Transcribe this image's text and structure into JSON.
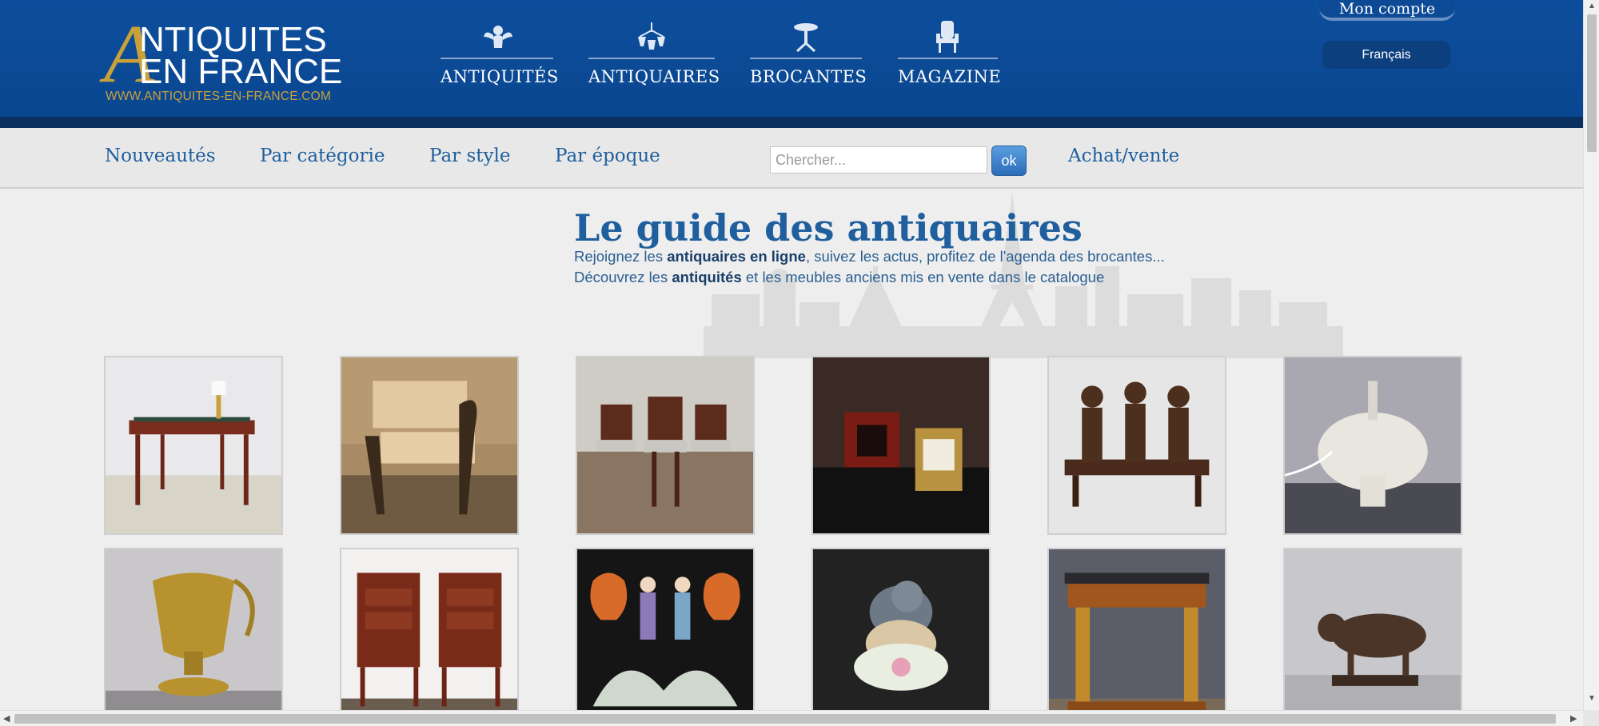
{
  "header": {
    "logo": {
      "big_letter": "A",
      "line1": "NTIQUITES",
      "line2": "EN FRANCE",
      "url": "WWW.ANTIQUITES-EN-FRANCE.COM"
    },
    "nav": [
      {
        "label": "ANTIQUITÉS",
        "icon": "cherub-icon"
      },
      {
        "label": "ANTIQUAIRES",
        "icon": "chandelier-icon"
      },
      {
        "label": "BROCANTES",
        "icon": "pedestal-table-icon"
      },
      {
        "label": "MAGAZINE",
        "icon": "armchair-icon"
      }
    ],
    "account_label": "Mon compte",
    "language_label": "Français"
  },
  "subnav": {
    "links": [
      "Nouveautés",
      "Par catégorie",
      "Par style",
      "Par époque"
    ],
    "search_placeholder": "Chercher...",
    "search_button": "ok",
    "buy_sell": "Achat/vente"
  },
  "main": {
    "title": "Le guide des antiquaires",
    "desc1_a": "Rejoignez les ",
    "desc1_b": "antiquaires en ligne",
    "desc1_c": ", suivez les actus, profitez de l'agenda des brocantes...",
    "desc2_a": "Découvrez les ",
    "desc2_b": "antiquités",
    "desc2_c": " et les meubles anciens mis en vente dans le catalogue"
  },
  "products": [
    {
      "name": "writing-desk"
    },
    {
      "name": "garden-bench"
    },
    {
      "name": "dining-chairs"
    },
    {
      "name": "carriage-clock"
    },
    {
      "name": "bronze-figures-bench"
    },
    {
      "name": "crackle-lamp"
    },
    {
      "name": "gilt-ewer"
    },
    {
      "name": "bedside-tables"
    },
    {
      "name": "porcelain-vases"
    },
    {
      "name": "porcelain-bird"
    },
    {
      "name": "console-table"
    },
    {
      "name": "bronze-bull"
    }
  ],
  "colors": {
    "header_blue": "#0d4e9c",
    "gold": "#c9a13b",
    "link_blue": "#1f5f9e"
  }
}
